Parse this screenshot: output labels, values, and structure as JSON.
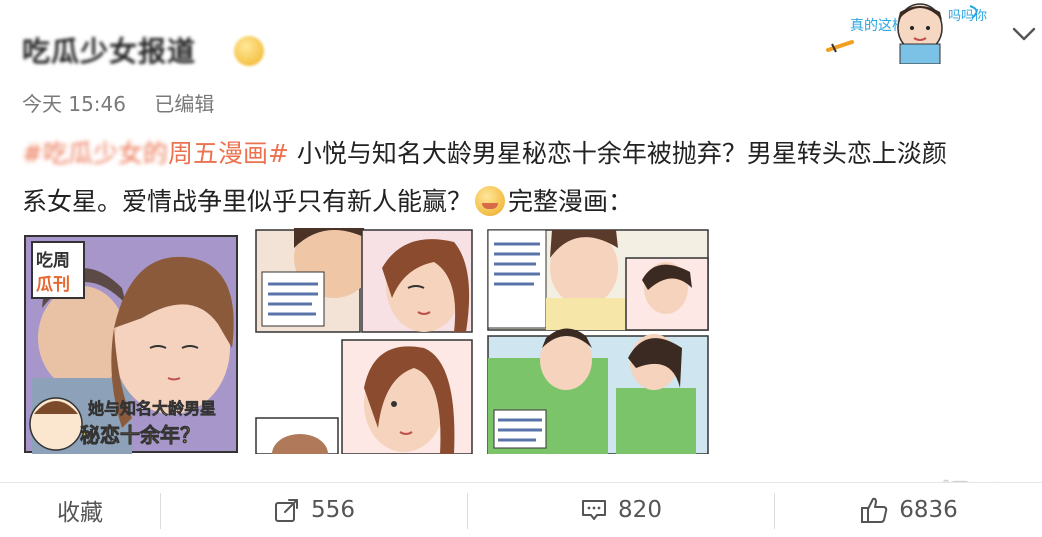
{
  "post": {
    "author": "吃瓜少女报道",
    "time": "今天 15:46",
    "edited": "已编辑",
    "topic_blurred": "#吃瓜少女的",
    "topic": "周五漫画#",
    "text_line1": " 小悦与知名大龄男星秘恋十余年被抛弃？男星转头恋上淡颜",
    "text_line2": "系女星。爱情战争里似乎只有新人能赢？",
    "text_after_emoji": "完整漫画："
  },
  "sticker": {
    "left_text": "真的这样",
    "right_text": "吗吗你"
  },
  "comics": {
    "badge_top": "吃周",
    "badge_bottom": "瓜刊",
    "caption1": "她与知名大龄男星",
    "caption2": "秘恋十余年？"
  },
  "footer": {
    "favorite": "收藏",
    "repost_count": "556",
    "comment_count": "820",
    "like_count": "6836"
  },
  "watermark": "娱sir",
  "colors": {
    "topic": "#eb7350",
    "meta": "#7a7a7a",
    "footer_text": "#555555"
  }
}
